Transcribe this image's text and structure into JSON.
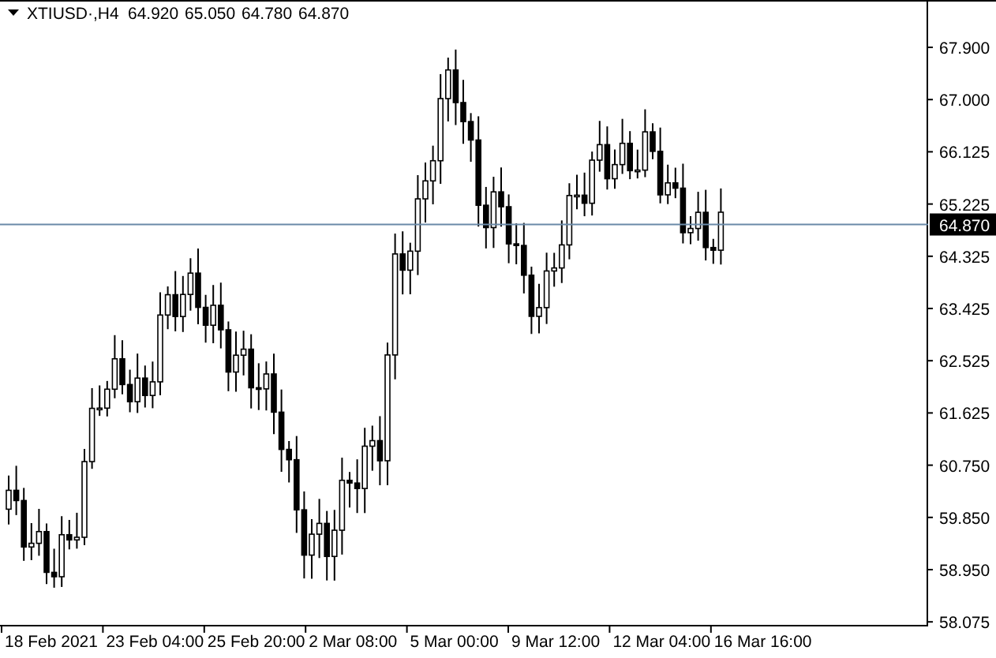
{
  "chart": {
    "symbol": "XTIUSD·,H4",
    "ohlc": [
      "64.920",
      "65.050",
      "64.780",
      "64.870"
    ],
    "price_axis": [
      "67.900",
      "67.000",
      "66.125",
      "65.225",
      "64.325",
      "63.425",
      "62.525",
      "61.625",
      "60.750",
      "59.850",
      "58.950",
      "58.075"
    ],
    "current_price": "64.870",
    "time_axis": [
      "18 Feb 2021",
      "23 Feb 04:00",
      "25 Feb 20:00",
      "2 Mar 08:00",
      "5 Mar 00:00",
      "9 Mar 12:00",
      "12 Mar 04:00",
      "16 Mar 16:00"
    ]
  }
}
